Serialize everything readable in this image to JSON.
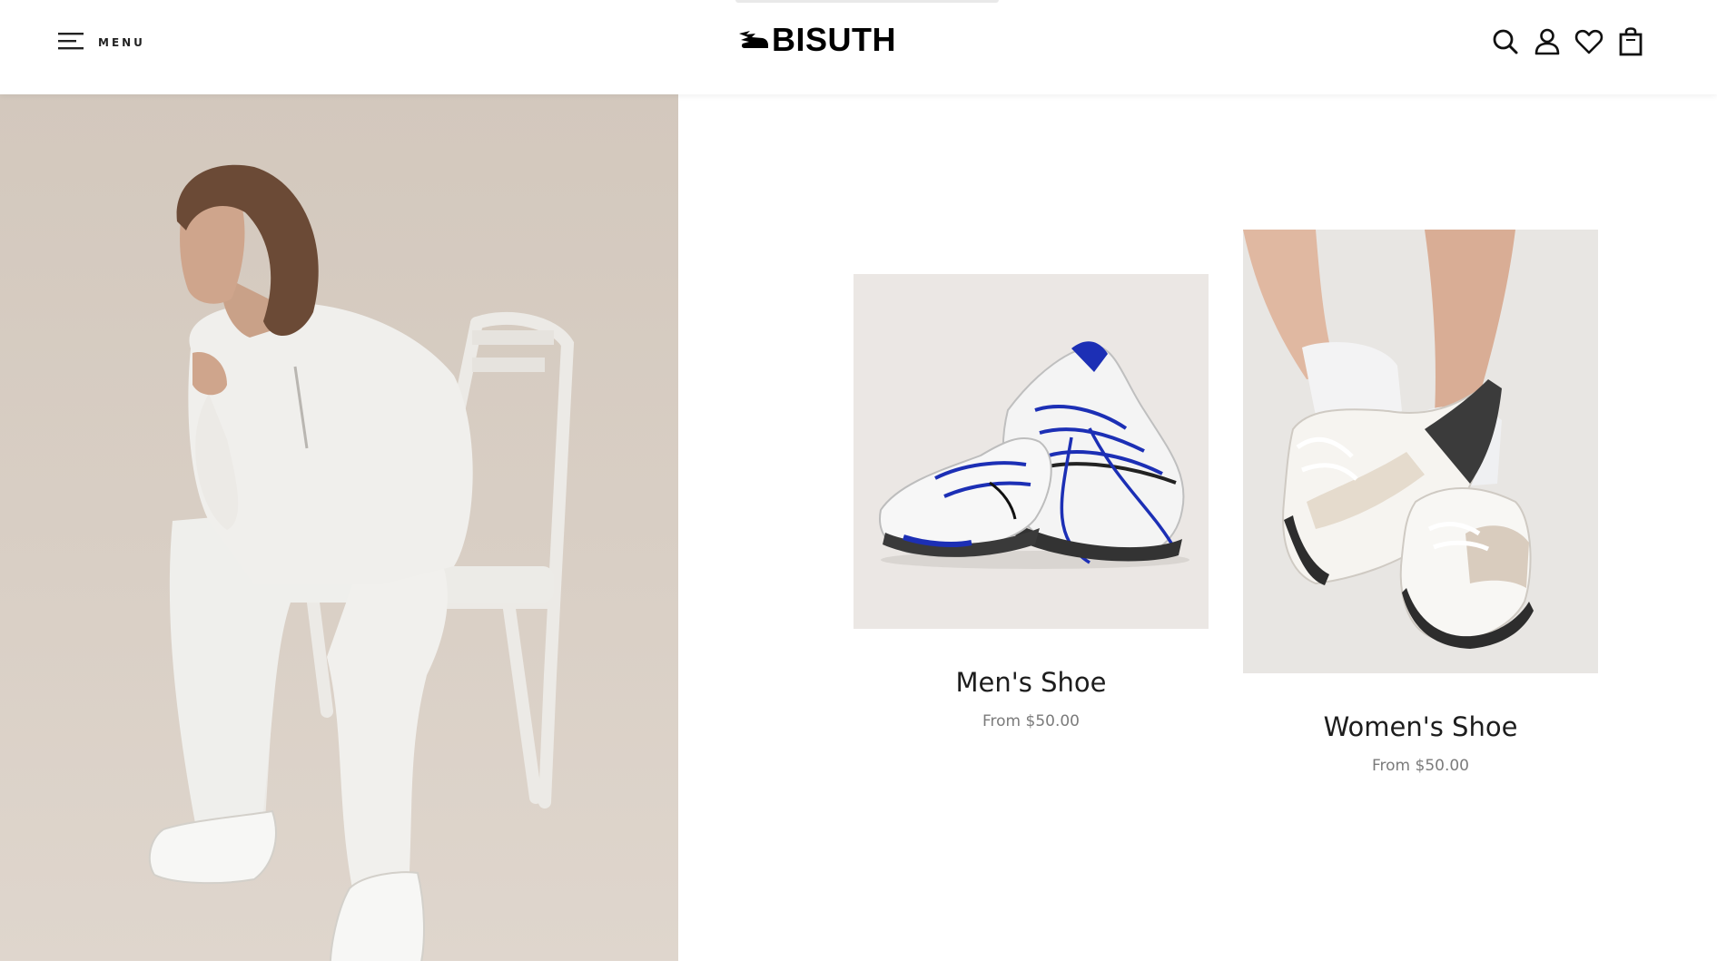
{
  "header": {
    "menu_label": "MENU",
    "brand": "BISUTH",
    "icons": [
      "search-icon",
      "account-icon",
      "wishlist-icon",
      "cart-icon"
    ]
  },
  "hero": {
    "image": "woman-in-white-outfit-seated-on-chair"
  },
  "collections": [
    {
      "title": "Men's Shoe",
      "price": "From $50.00",
      "image": "blue-laced-white-sneakers"
    },
    {
      "title": "Women's Shoe",
      "price": "From $50.00",
      "image": "beige-white-sneakers-on-feet"
    }
  ],
  "colors": {
    "hero_bg": "#d8cec4",
    "card_bg": "#ebe7e4",
    "text": "#1d1d1d",
    "muted": "#7b7b7b",
    "accent_blue": "#1c2fb5"
  }
}
